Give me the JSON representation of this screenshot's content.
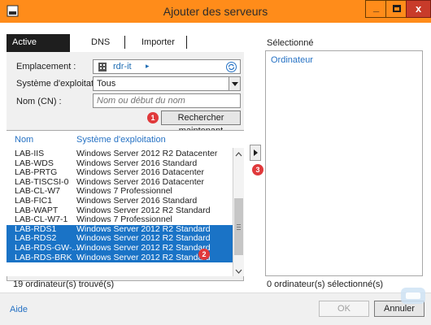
{
  "window": {
    "title": "Ajouter des serveurs",
    "minimize_glyph": "_",
    "close_glyph": "x",
    "accent_color": "#ff8c1a"
  },
  "tabs": [
    {
      "label": "Active Directory",
      "active": true
    },
    {
      "label": "DNS",
      "active": false
    },
    {
      "label": "Importer",
      "active": false
    }
  ],
  "form": {
    "location_label": "Emplacement :",
    "location_value": "rdr-it",
    "location_arrow": "▸",
    "os_label": "Système d'exploitation :",
    "os_value": "Tous",
    "cn_label": "Nom (CN) :",
    "cn_placeholder": "Nom ou début du nom",
    "search_button": "Rechercher maintenant"
  },
  "results": {
    "columns": [
      "Nom",
      "Système d'exploitation"
    ],
    "rows": [
      {
        "name": "LAB-IIS",
        "os": "Windows Server 2012 R2 Datacenter",
        "selected": false
      },
      {
        "name": "LAB-WDS",
        "os": "Windows Server 2016 Standard",
        "selected": false
      },
      {
        "name": "LAB-PRTG",
        "os": "Windows Server 2016 Datacenter",
        "selected": false
      },
      {
        "name": "LAB-TISCSI-0",
        "os": "Windows Server 2016 Datacenter",
        "selected": false
      },
      {
        "name": "LAB-CL-W7",
        "os": "Windows 7 Professionnel",
        "selected": false
      },
      {
        "name": "LAB-FIC1",
        "os": "Windows Server 2016 Standard",
        "selected": false
      },
      {
        "name": "LAB-WAPT",
        "os": "Windows Server 2012 R2 Standard",
        "selected": false
      },
      {
        "name": "LAB-CL-W7-1",
        "os": "Windows 7 Professionnel",
        "selected": false
      },
      {
        "name": "LAB-RDS1",
        "os": "Windows Server 2012 R2 Standard",
        "selected": true
      },
      {
        "name": "LAB-RDS2",
        "os": "Windows Server 2012 R2 Standard",
        "selected": true
      },
      {
        "name": "LAB-RDS-GW-...",
        "os": "Windows Server 2012 R2 Standard",
        "selected": true
      },
      {
        "name": "LAB-RDS-BRK",
        "os": "Windows Server 2012 R2 Standard",
        "selected": true
      }
    ],
    "found_text": "19 ordinateur(s) trouvé(s)",
    "selection_color": "#1a73c6"
  },
  "selected_panel": {
    "title": "Sélectionné",
    "column": "Ordinateur",
    "count_text": "0 ordinateur(s) sélectionné(s)"
  },
  "footer": {
    "help": "Aide",
    "ok": "OK",
    "cancel": "Annuler"
  },
  "badges": [
    "1",
    "2",
    "3"
  ],
  "badge_color": "#e0393b",
  "icons": [
    "server-manager-icon",
    "minimize-icon",
    "maximize-icon",
    "close-icon",
    "domain-icon",
    "refresh-icon",
    "dropdown-arrow-icon",
    "scroll-up-icon",
    "scroll-down-icon",
    "add-arrow-icon",
    "rdr-it-watermark"
  ]
}
